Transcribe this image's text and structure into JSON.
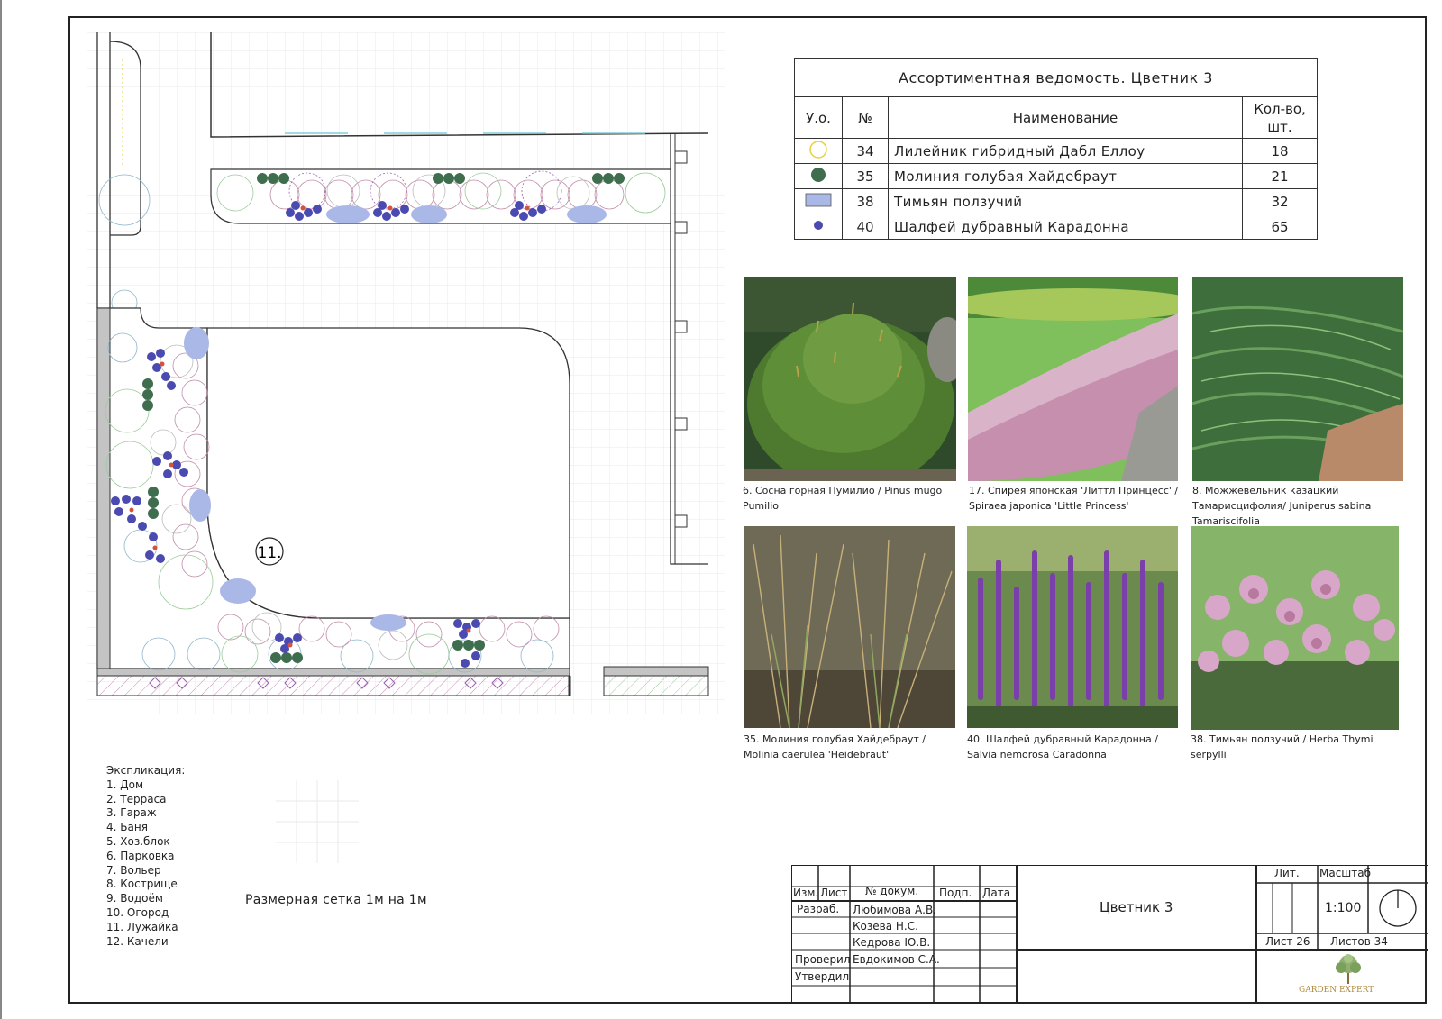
{
  "assortment_table": {
    "title": "Ассортиментная ведомость. Цветник 3",
    "headers": {
      "symbol": "У.о.",
      "number": "№",
      "name": "Наименование",
      "qty": "Кол-во, шт."
    },
    "rows": [
      {
        "symbol": "yellow-ring-icon",
        "number": "34",
        "name": "Лилейник гибридный Дабл Еллоу",
        "qty": "18"
      },
      {
        "symbol": "green-dot-icon",
        "number": "35",
        "name": "Молиния голубая Хайдебраут",
        "qty": "21"
      },
      {
        "symbol": "blue-rect-icon",
        "number": "38",
        "name": "Тимьян ползучий",
        "qty": "32"
      },
      {
        "symbol": "purple-dot-icon",
        "number": "40",
        "name": "Шалфей дубравный Карадонна",
        "qty": "65"
      }
    ]
  },
  "photos": [
    {
      "caption": "6. Сосна горная Пумилио / Pinus mugo Pumilio"
    },
    {
      "caption": "17. Спирея японская 'Литтл Принцесс' / Spiraea japonica 'Little Princess'"
    },
    {
      "caption": "8. Можжевельник казацкий Тамарисцифолия/ Juniperus sabina Tamariscifolia"
    },
    {
      "caption": "35. Молиния голубая Хайдебраут / Molinia caerulea 'Heidebraut'"
    },
    {
      "caption": "40. Шалфей дубравный Карадонна / Salvia nemorosa Caradonna"
    },
    {
      "caption": "38. Тимьян ползучий / Herba Thymi serpylli"
    }
  ],
  "plan": {
    "lawn_marker": "11."
  },
  "legend": {
    "title": "Экспликация:",
    "items": [
      "1. Дом",
      "2. Терраса",
      "3. Гараж",
      "4. Баня",
      "5. Хоз.блок",
      "6. Парковка",
      "7. Вольер",
      "8. Кострище",
      "9. Водоём",
      "10. Огород",
      "11. Лужайка",
      "12. Качели"
    ]
  },
  "grid_note": "Размерная сетка 1м на 1м",
  "stamp": {
    "col_izm": "Изм.",
    "col_list": "Лист",
    "col_doc": "№ докум.",
    "col_podp": "Подп.",
    "col_date": "Дата",
    "razrab_label": "Разраб.",
    "proveril_label": "Проверил",
    "utverdil_label": "Утвердил",
    "people": [
      "Любимова А.В.",
      "Козева Н.С.",
      "Кедрова Ю.В.",
      "Евдокимов С.А."
    ],
    "drawing_title": "Цветник 3",
    "lit_label": "Лит.",
    "scale_label": "Масштаб",
    "scale_value": "1:100",
    "sheet": "Лист 26",
    "sheets": "Листов 34",
    "logo_text": "GARDEN EXPERT"
  },
  "colors": {
    "green": "#3f6e4f",
    "purple": "#4a4ab0",
    "blue_fill": "#a9b8e6",
    "yellow": "#e6d23a",
    "red": "#d8513a"
  }
}
